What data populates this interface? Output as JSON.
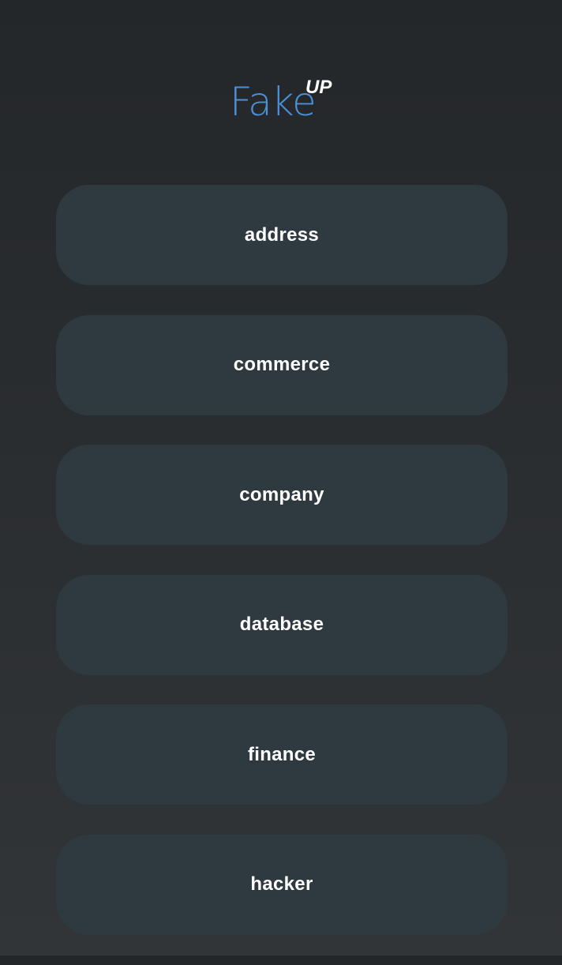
{
  "logo": {
    "main_text": "Fake",
    "superscript_text": "UP",
    "accent_color": "#4a90d9"
  },
  "menu": {
    "items": [
      {
        "label": "address"
      },
      {
        "label": "commerce"
      },
      {
        "label": "company"
      },
      {
        "label": "database"
      },
      {
        "label": "finance"
      },
      {
        "label": "hacker"
      }
    ]
  }
}
